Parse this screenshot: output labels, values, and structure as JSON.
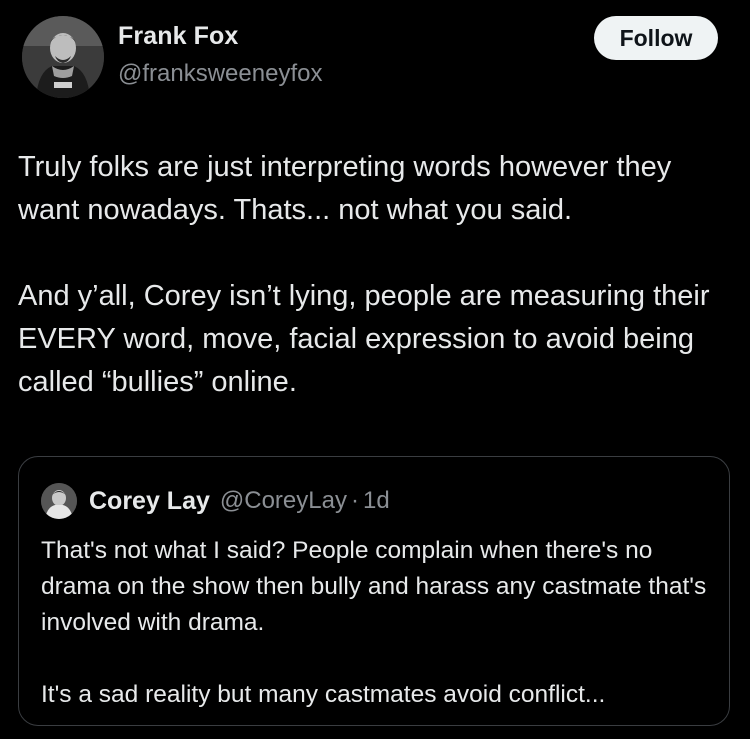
{
  "author": {
    "name": "Frank Fox",
    "handle": "@franksweeneyfox",
    "avatar_icon": "profile-photo"
  },
  "follow_button": {
    "label": "Follow"
  },
  "tweet": {
    "paragraphs": [
      "Truly folks are just interpreting words however they want nowadays. Thats... not what you said.",
      "And y’all, Corey isn’t lying, people are measuring their EVERY word, move, facial expression to avoid being called “bullies” online."
    ]
  },
  "quoted_tweet": {
    "author_name": "Corey Lay",
    "author_handle": "@CoreyLay",
    "separator": "·",
    "time": "1d",
    "paragraphs": [
      "That's not what I said? People complain when there's no drama on the show then bully and harass any castmate that's involved with drama.",
      "It's a sad reality but many castmates avoid conflict..."
    ]
  },
  "colors": {
    "background": "#000000",
    "text_primary": "#e7e9ea",
    "text_secondary": "#8b8f94",
    "follow_button_bg": "#eff3f4",
    "quote_border": "#3a3d41"
  }
}
